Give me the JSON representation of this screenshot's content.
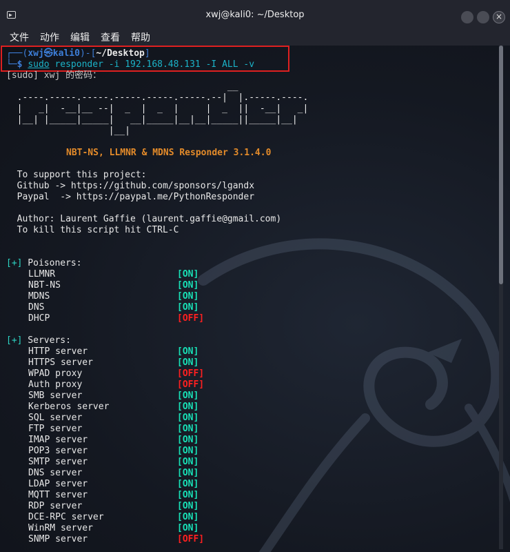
{
  "window": {
    "title": "xwj@kali0: ~/Desktop"
  },
  "menu": {
    "file": "文件",
    "actions": "动作",
    "edit": "编辑",
    "view": "查看",
    "help": "帮助"
  },
  "prompt": {
    "top_left": "┌──(",
    "user": "xwj㉿kali0",
    "mid": ")-[",
    "path": "~/Desktop",
    "top_end": "]",
    "bottom_left": "└─",
    "dollar": "$ ",
    "cmd": "sudo",
    "args": " responder -i 192.168.48.131 -I ALL -v"
  },
  "sudo_line": "[sudo] xwj 的密码：",
  "banner": [
    "                                         __",
    "  .----.-----.-----.-----.-----.-----.--|  |.-----.----.",
    "  |   _|  -__|__ --|  _  |  _  |     |  _  ||  -__|   _|",
    "  |__| |_____|_____|   __|_____|__|__|_____||_____|__|",
    "                   |__|"
  ],
  "product": "NBT-NS, LLMNR & MDNS Responder 3.1.4.0",
  "support": {
    "line1": "  To support this project:",
    "github": "  Github -> https://github.com/sponsors/lgandx",
    "paypal": "  Paypal  -> https://paypal.me/PythonResponder",
    "author": "  Author: Laurent Gaffie (laurent.gaffie@gmail.com)",
    "kill": "  To kill this script hit CTRL-C"
  },
  "poisoners": {
    "tag": "[+]",
    "label": " Poisoners:",
    "items": [
      {
        "name": "LLMNR",
        "state": "[ON]"
      },
      {
        "name": "NBT-NS",
        "state": "[ON]"
      },
      {
        "name": "MDNS",
        "state": "[ON]"
      },
      {
        "name": "DNS",
        "state": "[ON]"
      },
      {
        "name": "DHCP",
        "state": "[OFF]"
      }
    ]
  },
  "servers": {
    "tag": "[+]",
    "label": " Servers:",
    "items": [
      {
        "name": "HTTP server",
        "state": "[ON]"
      },
      {
        "name": "HTTPS server",
        "state": "[ON]"
      },
      {
        "name": "WPAD proxy",
        "state": "[OFF]"
      },
      {
        "name": "Auth proxy",
        "state": "[OFF]"
      },
      {
        "name": "SMB server",
        "state": "[ON]"
      },
      {
        "name": "Kerberos server",
        "state": "[ON]"
      },
      {
        "name": "SQL server",
        "state": "[ON]"
      },
      {
        "name": "FTP server",
        "state": "[ON]"
      },
      {
        "name": "IMAP server",
        "state": "[ON]"
      },
      {
        "name": "POP3 server",
        "state": "[ON]"
      },
      {
        "name": "SMTP server",
        "state": "[ON]"
      },
      {
        "name": "DNS server",
        "state": "[ON]"
      },
      {
        "name": "LDAP server",
        "state": "[ON]"
      },
      {
        "name": "MQTT server",
        "state": "[ON]"
      },
      {
        "name": "RDP server",
        "state": "[ON]"
      },
      {
        "name": "DCE-RPC server",
        "state": "[ON]"
      },
      {
        "name": "WinRM server",
        "state": "[ON]"
      },
      {
        "name": "SNMP server",
        "state": "[OFF]"
      }
    ]
  },
  "icons": {
    "app": "terminal-icon",
    "min": "minimize-icon",
    "max": "maximize-icon",
    "close": "close-icon"
  },
  "colors": {
    "on": "#18e0b6",
    "off": "#ff2020",
    "orange": "#e48b2a",
    "blue": "#3d7ed8"
  }
}
